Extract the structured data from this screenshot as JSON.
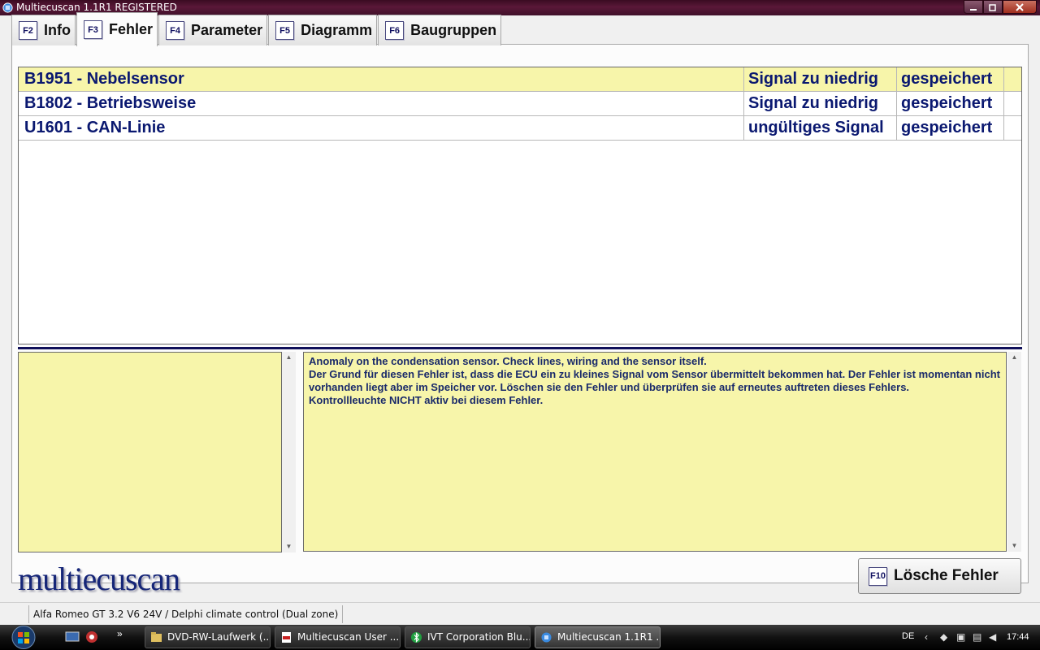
{
  "window": {
    "title": "Multiecuscan 1.1R1 REGISTERED"
  },
  "tabs": [
    {
      "key": "F2",
      "label": "Info"
    },
    {
      "key": "F3",
      "label": "Fehler"
    },
    {
      "key": "F4",
      "label": "Parameter"
    },
    {
      "key": "F5",
      "label": "Diagramm"
    },
    {
      "key": "F6",
      "label": "Baugruppen"
    }
  ],
  "faults": [
    {
      "code": "B1951 - Nebelsensor",
      "desc": "Signal zu niedrig",
      "state": "gespeichert"
    },
    {
      "code": "B1802 - Betriebsweise",
      "desc": "Signal zu niedrig",
      "state": "gespeichert"
    },
    {
      "code": "U1601 - CAN-Linie",
      "desc": "ungültiges Signal",
      "state": "gespeichert"
    }
  ],
  "detail": {
    "lines": [
      "Anomaly on the condensation sensor. Check lines, wiring and the sensor itself.",
      "Der Grund für diesen Fehler ist, dass die ECU ein zu kleines Signal vom Sensor übermittelt bekommen hat. Der Fehler ist momentan nicht vorhanden liegt aber im Speicher vor. Löschen sie den Fehler und überprüfen sie auf erneutes auftreten dieses Fehlers.",
      "Kontrollleuchte NICHT aktiv bei diesem Fehler."
    ]
  },
  "logo": "multiecuscan",
  "clear_button": {
    "key": "F10",
    "label": "Lösche Fehler"
  },
  "status": {
    "vehicle": "Alfa Romeo GT 3.2 V6 24V / Delphi climate control (Dual zone)"
  },
  "taskbar": {
    "tasks": [
      {
        "label": "DVD-RW-Laufwerk (..."
      },
      {
        "label": "Multiecuscan User ..."
      },
      {
        "label": "IVT Corporation Blu..."
      },
      {
        "label": "Multiecuscan 1.1R1 ..."
      }
    ],
    "lang": "DE",
    "time": "17:44"
  },
  "colors": {
    "accent": "#0a1870",
    "selection": "#f7f5aa",
    "titlebar": "#4a1030"
  }
}
